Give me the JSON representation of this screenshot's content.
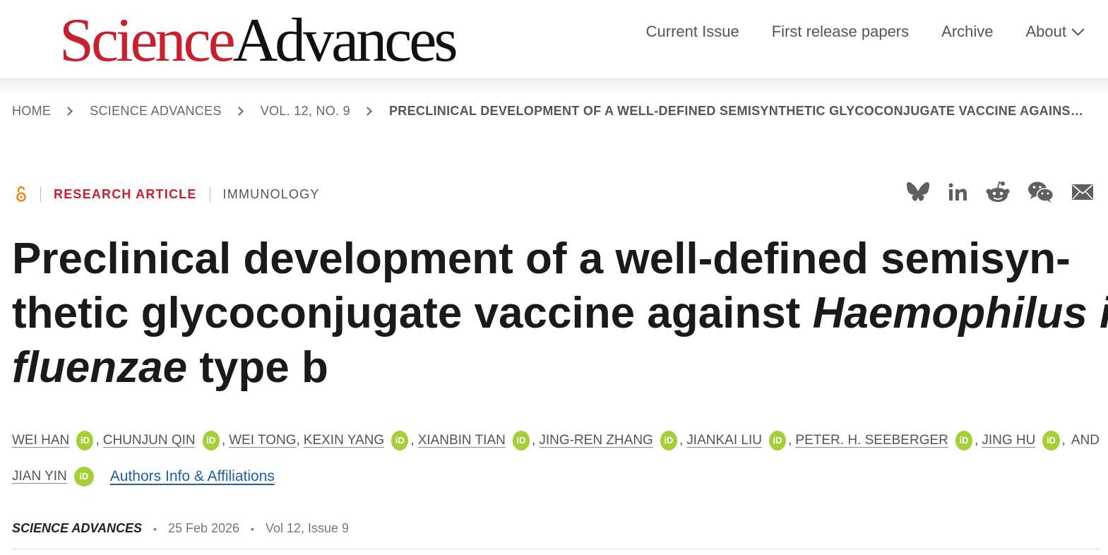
{
  "header": {
    "logo_science": "Science",
    "logo_advances": "Advances",
    "nav": [
      {
        "label": "Current Issue"
      },
      {
        "label": "First release papers"
      },
      {
        "label": "Archive"
      },
      {
        "label": "About",
        "icon": "chevron-down-icon"
      }
    ]
  },
  "breadcrumb": {
    "items": [
      "HOME",
      "SCIENCE ADVANCES",
      "VOL. 12, NO. 9"
    ],
    "current": "PRECLINICAL DEVELOPMENT OF A WELL-DEFINED SEMISYNTHETIC GLYCOCONJUGATE VACCINE AGAINST HAEMOPHILUS INFLUENZAE TYPE B"
  },
  "article": {
    "access_icon": "open-access-icon",
    "type": "RESEARCH ARTICLE",
    "subject": "IMMUNOLOGY",
    "share_icons": [
      "bluesky-icon",
      "linkedin-icon",
      "reddit-icon",
      "wechat-icon",
      "email-icon"
    ],
    "title": {
      "line1": "Preclinical development of a well-defined semisyn-",
      "line2_a": "thetic glycoconjugate vaccine against ",
      "line2_b": "Haemophilus in-",
      "line3_a": "fluenzae",
      "line3_b": " type b"
    },
    "authors": [
      "WEI HAN",
      "CHUNJUN QIN",
      "WEI TONG",
      "KEXIN YANG",
      "XIANBIN TIAN",
      "JING-REN ZHANG",
      "JIANKAI LIU",
      "PETER. H. SEEBERGER",
      "JING HU",
      "JIAN YIN"
    ],
    "orcid_label": "iD",
    "and_word": "AND",
    "affiliations_link": "Authors Info & Affiliations",
    "journal": "SCIENCE ADVANCES",
    "date": "25 Feb 2026",
    "volume": "Vol 12, Issue 9",
    "colors": {
      "brand_red": "#c8202f",
      "orcid_green": "#a6ce39",
      "link_blue": "#1f5ea8",
      "open_access_orange": "#f68212"
    }
  }
}
